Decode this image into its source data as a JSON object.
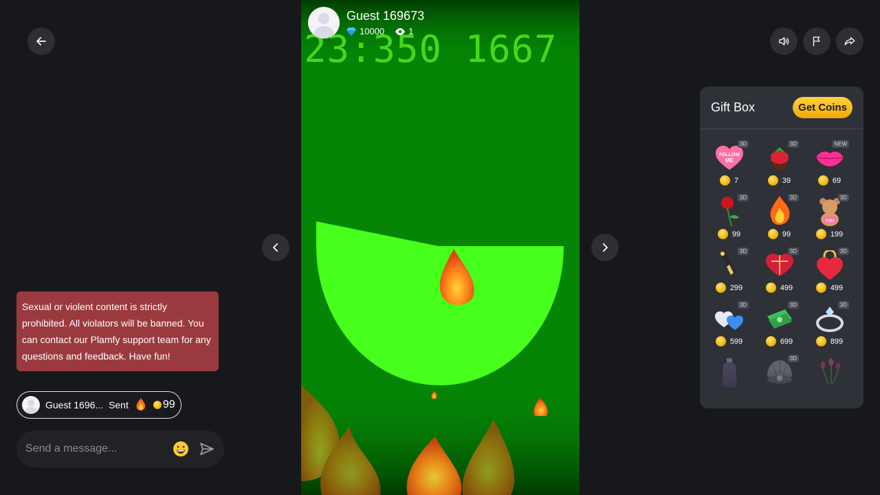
{
  "host": {
    "name": "Guest 169673",
    "diamonds": "10000",
    "viewers": "1"
  },
  "stream": {
    "overlay_text": "23:350 1667"
  },
  "chat": {
    "notice": "Sexual or violent content is strictly prohibited. All violators will be banned. You can contact our Plamfy support team for any questions and feedback. Have fun!",
    "sent_event": {
      "user": "Guest 1696...",
      "action": "Sent",
      "gift_icon": "fire-icon",
      "amount": "99"
    },
    "input_placeholder": "Send a message..."
  },
  "gift_box": {
    "title": "Gift Box",
    "get_coins_label": "Get Coins",
    "gifts": [
      {
        "icon": "follow-me-heart-icon",
        "badge": "3D",
        "price": "7"
      },
      {
        "icon": "strawberry-icon",
        "badge": "3D",
        "price": "39"
      },
      {
        "icon": "lips-icon",
        "badge": "NEW",
        "price": "69"
      },
      {
        "icon": "rose-icon",
        "badge": "3D",
        "price": "99"
      },
      {
        "icon": "fire-icon",
        "badge": "3D",
        "price": "99"
      },
      {
        "icon": "teddy-bear-icon",
        "badge": "3D",
        "price": "199"
      },
      {
        "icon": "champagne-icon",
        "badge": "3D",
        "price": "299"
      },
      {
        "icon": "chocolate-box-icon",
        "badge": "3D",
        "price": "499"
      },
      {
        "icon": "heart-lock-icon",
        "badge": "3D",
        "price": "499"
      },
      {
        "icon": "hearts-icon",
        "badge": "3D",
        "price": "599"
      },
      {
        "icon": "money-icon",
        "badge": "3D",
        "price": "699"
      },
      {
        "icon": "ring-icon",
        "badge": "3D",
        "price": "899"
      },
      {
        "icon": "perfume-icon",
        "badge": "",
        "price": ""
      },
      {
        "icon": "pearl-shell-icon",
        "badge": "3D",
        "price": ""
      },
      {
        "icon": "tulips-icon",
        "badge": "",
        "price": ""
      }
    ]
  }
}
